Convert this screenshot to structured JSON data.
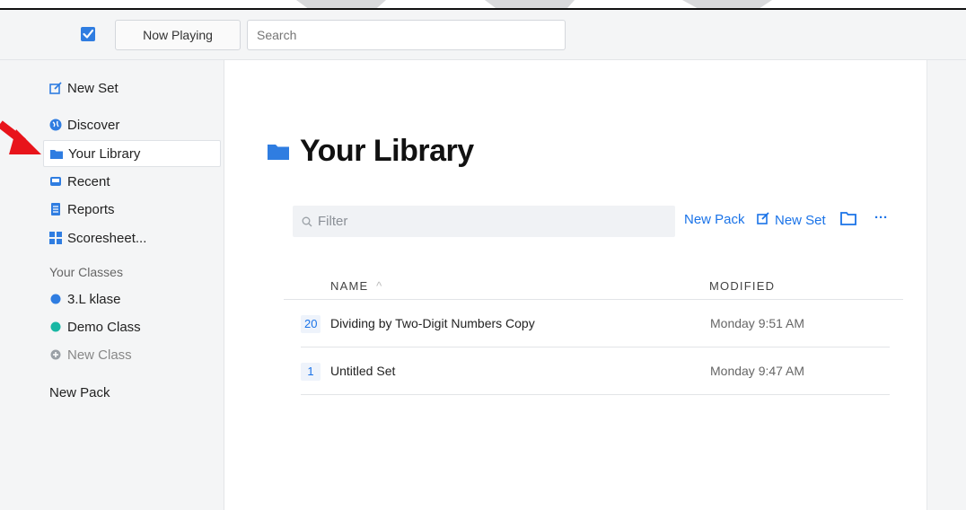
{
  "topbar": {
    "now_playing_label": "Now Playing",
    "search_placeholder": "Search"
  },
  "sidebar": {
    "new_set": "New Set",
    "nav": [
      {
        "label": "Discover",
        "icon": "globe-icon"
      },
      {
        "label": "Your Library",
        "icon": "folder-icon",
        "active": true
      },
      {
        "label": "Recent",
        "icon": "inbox-icon"
      },
      {
        "label": "Reports",
        "icon": "document-icon"
      },
      {
        "label": "Scoresheet...",
        "icon": "grid-icon"
      }
    ],
    "classes_heading": "Your Classes",
    "classes": [
      {
        "label": "3.L klase",
        "color": "#2f7de1"
      },
      {
        "label": "Demo Class",
        "color": "#19b7a4"
      }
    ],
    "new_class": "New Class",
    "new_pack": "New Pack"
  },
  "main": {
    "title": "Your Library",
    "filter_placeholder": "Filter",
    "actions": {
      "new_pack": "New Pack",
      "new_set": "New Set",
      "more": "···"
    },
    "table": {
      "col_name": "NAME",
      "col_modified": "MODIFIED",
      "sort_indicator": "^",
      "rows": [
        {
          "count": "20",
          "name": "Dividing by Two-Digit Numbers Copy",
          "modified": "Monday 9:51 AM"
        },
        {
          "count": "1",
          "name": "Untitled Set",
          "modified": "Monday 9:47 AM"
        }
      ]
    }
  },
  "colors": {
    "accent": "#1a73e8",
    "annotation_arrow": "#e8141b"
  }
}
